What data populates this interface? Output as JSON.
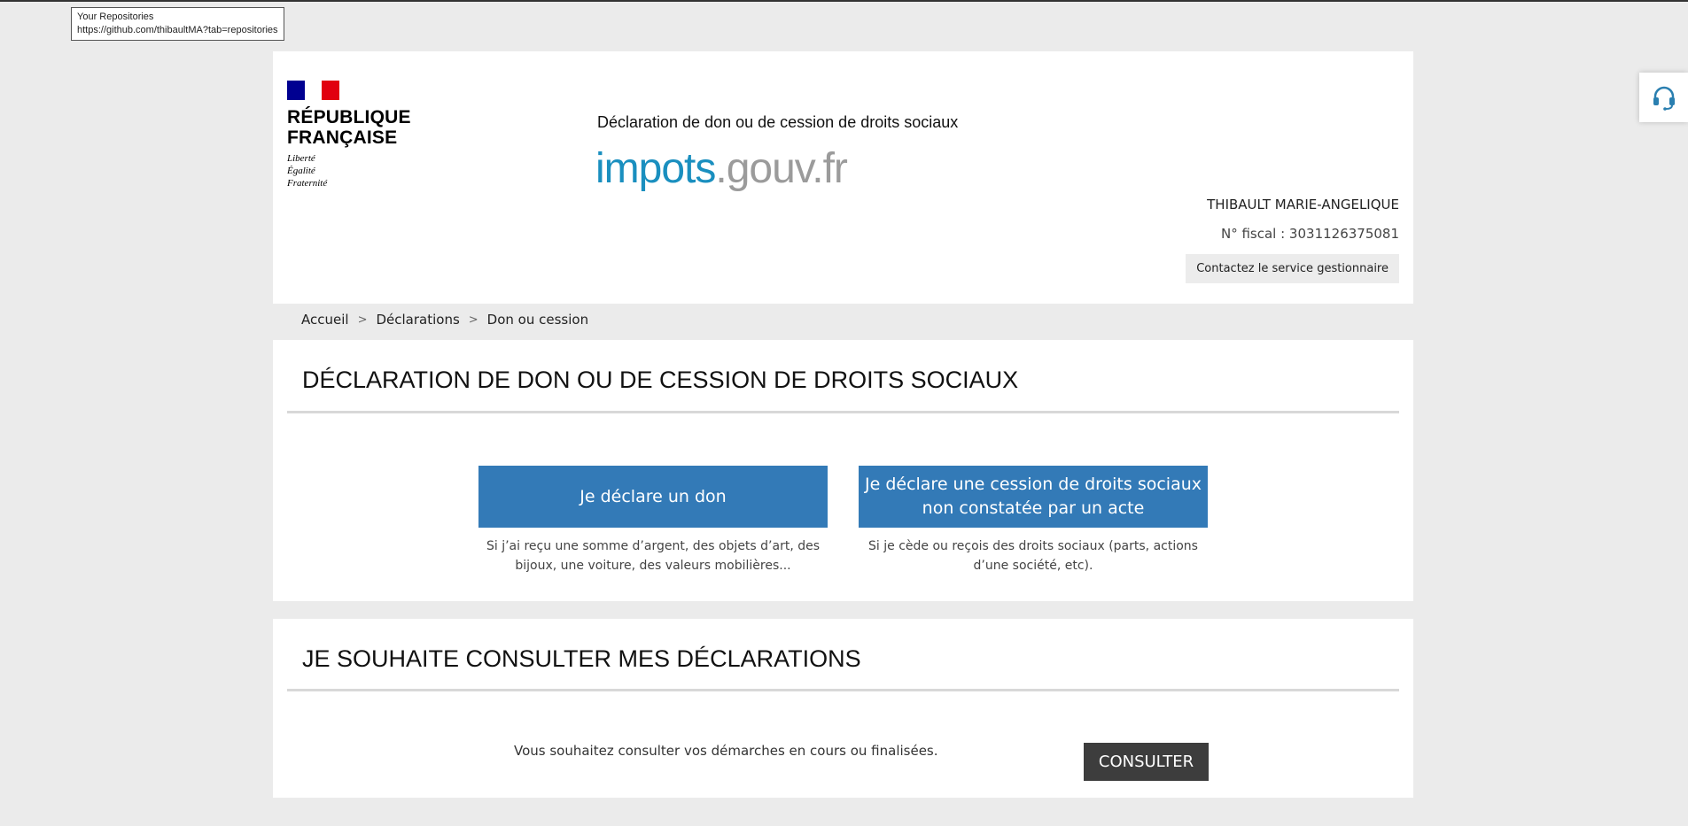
{
  "tooltip": {
    "title": "Your Repositories",
    "url": "https://github.com/thibaultMA?tab=repositories"
  },
  "header": {
    "republique_name": "RÉPUBLIQUE\nFRANÇAISE",
    "motto": "Liberté\nÉgalité\nFraternité",
    "service_title": "Déclaration de don ou de cession de droits sociaux",
    "brand": {
      "part1": "impots",
      "part2": ".gouv",
      "part3": ".fr"
    },
    "user_name": "THIBAULT MARIE-ANGELIQUE",
    "fiscal_number": "N° fiscal : 3031126375081",
    "contact_button": "Contactez le service gestionnaire"
  },
  "breadcrumb": {
    "items": [
      "Accueil",
      "Déclarations",
      "Don ou cession"
    ],
    "separator": ">"
  },
  "declaration_section": {
    "title": "DÉCLARATION DE DON OU DE CESSION DE DROITS SOCIAUX",
    "don_button": "Je déclare un don",
    "don_description": "Si j’ai reçu une somme d’argent, des objets d’art, des bijoux, une voiture, des valeurs mobilières...",
    "cession_button": "Je déclare une cession de droits sociaux non constatée par un acte",
    "cession_description": "Si je cède ou reçois des droits sociaux (parts, actions d’une société, etc)."
  },
  "consult_section": {
    "title": "JE SOUHAITE CONSULTER MES DÉCLARATIONS",
    "text": "Vous souhaitez consulter vos démarches en cours ou finalisées.",
    "button": "CONSULTER"
  },
  "colors": {
    "primary_button": "#337ab7",
    "consult_button": "#3d3d3d",
    "brand_blue": "#1a8fbf",
    "brand_grey": "#9b9b9b",
    "flag_blue": "#000091",
    "flag_red": "#e1000f"
  },
  "icons": {
    "help": "headset-icon"
  }
}
